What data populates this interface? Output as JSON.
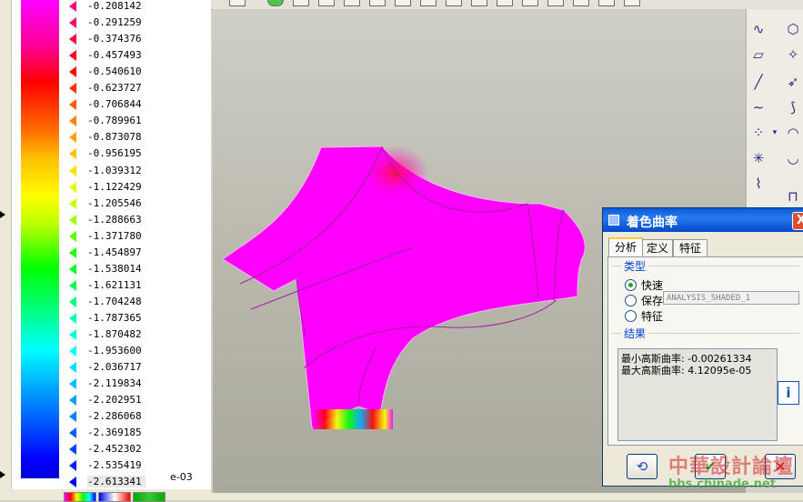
{
  "legend": {
    "values": [
      "-0.208142",
      "-0.291259",
      "-0.374376",
      "-0.457493",
      "-0.540610",
      "-0.623727",
      "-0.706844",
      "-0.789961",
      "-0.873078",
      "-0.956195",
      "-1.039312",
      "-1.122429",
      "-1.205546",
      "-1.288663",
      "-1.371780",
      "-1.454897",
      "-1.538014",
      "-1.621131",
      "-1.704248",
      "-1.787365",
      "-1.870482",
      "-1.953600",
      "-2.036717",
      "-2.119834",
      "-2.202951",
      "-2.286068",
      "-2.369185",
      "-2.452302",
      "-2.535419",
      "-2.613341"
    ],
    "marker_colors": [
      "#ff0080",
      "#ff0060",
      "#ff0040",
      "#ff0020",
      "#ff0000",
      "#ff3000",
      "#ff5a00",
      "#ff8000",
      "#ffa000",
      "#ffc000",
      "#ffe000",
      "#e0ff00",
      "#c0ff00",
      "#a0ff00",
      "#60ff00",
      "#20ff00",
      "#00ff20",
      "#00ff50",
      "#00ff80",
      "#00ffb0",
      "#00ffd8",
      "#00ffff",
      "#00e0ff",
      "#00c0ff",
      "#00a0ff",
      "#0080ff",
      "#0060ff",
      "#0040ff",
      "#0020ff",
      "#0000ff"
    ],
    "exponent": "e-03"
  },
  "dialog": {
    "title": "着色曲率",
    "close": "X",
    "tabs": [
      {
        "label": "分析",
        "active": true
      },
      {
        "label": "定义",
        "active": false
      },
      {
        "label": "特征",
        "active": false
      }
    ],
    "type_group": {
      "label": "类型",
      "options": [
        {
          "label": "快速",
          "checked": true
        },
        {
          "label": "保存",
          "checked": false
        },
        {
          "label": "特征",
          "checked": false
        }
      ],
      "save_name": "ANALYSIS_SHADED_1"
    },
    "result_group": {
      "label": "结果",
      "lines": [
        "最小高斯曲率: -0.00261334",
        "最大高斯曲率: 4.12095e-05"
      ]
    },
    "info_icon": "i",
    "buttons": {
      "repeat_icon": "⟲",
      "ok_icon": "✔",
      "cancel_icon": "✕"
    }
  },
  "watermark": {
    "text": "中華設計論壇",
    "url": "bbs.chinade.net"
  }
}
